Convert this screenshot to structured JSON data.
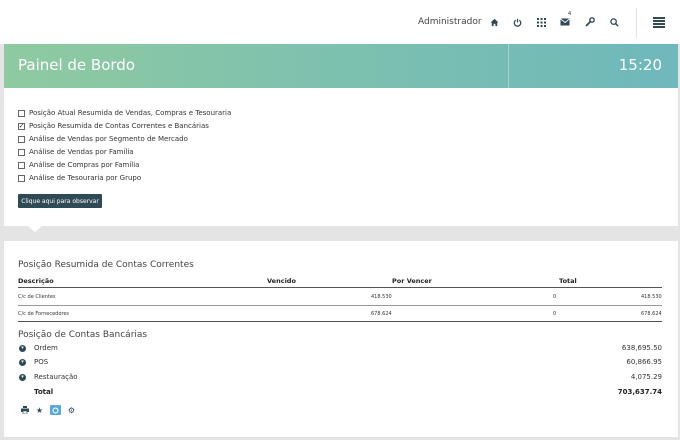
{
  "header": {
    "user": "Administrador",
    "icons": [
      "home-icon",
      "power-icon",
      "apps-grid-icon",
      "mail-icon",
      "wrench-icon",
      "search-icon",
      "menu-icon"
    ],
    "mail_badge": "4"
  },
  "banner": {
    "title": "Painel de Bordo",
    "time": "15:20"
  },
  "options": [
    {
      "label": "Posição Atual Resumida de Vendas, Compras e Tesouraria",
      "checked": false
    },
    {
      "label": "Posição Resumida de Contas Correntes e Bancárias",
      "checked": true
    },
    {
      "label": "Análise de Vendas por Segmento de Mercado",
      "checked": false
    },
    {
      "label": "Análise de Vendas por Família",
      "checked": false
    },
    {
      "label": "Análise de Compras por Família",
      "checked": false
    },
    {
      "label": "Análise de Tesouraria por Grupo",
      "checked": false
    }
  ],
  "observe_button": "Clique aqui para observar",
  "accounts": {
    "title": "Posição Resumida de Contas Correntes",
    "columns": [
      "Descrição",
      "Vencido",
      "Por Vencer",
      "Total"
    ],
    "rows": [
      {
        "desc": "C/c de Clientes",
        "vencido": "418.530",
        "por_vencer": "0",
        "total": "418.530"
      },
      {
        "desc": "C/c de Fornecedores",
        "vencido": "678.624",
        "por_vencer": "0",
        "total": "678.624"
      }
    ]
  },
  "banks": {
    "title": "Posição de Contas Bancárias",
    "rows": [
      {
        "label": "Ordem",
        "value": "638,695.50"
      },
      {
        "label": "POS",
        "value": "60,866.95"
      },
      {
        "label": "Restauração",
        "value": "4,075.29"
      }
    ],
    "total_label": "Total",
    "total_value": "703,637.74"
  },
  "toolbar_icons": [
    "print-icon",
    "star-icon",
    "refresh-icon",
    "settings-icon"
  ],
  "colors": {
    "banner_start": "#8fcaa0",
    "banner_end": "#6fb8bb",
    "button": "#2f4a55",
    "active_tool": "#5aa9d9"
  }
}
